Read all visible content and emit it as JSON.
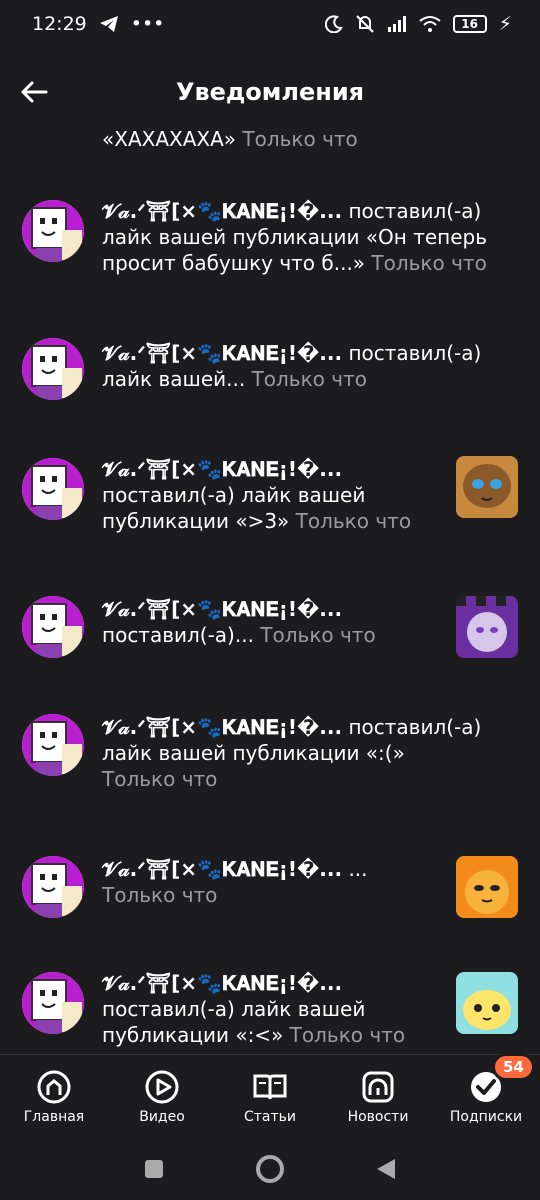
{
  "status_bar": {
    "time": "12:29",
    "battery": "16"
  },
  "header": {
    "title": "Уведомления"
  },
  "partial_top": {
    "text": "«ХАХАХАХА»",
    "time": "Только что"
  },
  "notifications": [
    {
      "username": "𝓥𝒶.ᐟ⛩[×🐾𝐊𝐀𝐍𝐄¡!�...",
      "line1": "поставил(-а)",
      "line2": "лайк вашей публикации «Он теперь",
      "line3": "просит бабушку что б...»",
      "time": "Только что",
      "thumb": ""
    },
    {
      "username": "𝓥𝒶.ᐟ⛩[×🐾𝐊𝐀𝐍𝐄¡!�...",
      "line1": "поставил(-а)",
      "line2": "лайк вашей...",
      "time": "Только что",
      "thumb": ""
    },
    {
      "username": "𝓥𝒶.ᐟ⛩[×🐾𝐊𝐀𝐍𝐄¡!�...",
      "line2": "поставил(-а) лайк вашей",
      "line3": "публикации «>3»",
      "time": "Только что",
      "thumb": "brown"
    },
    {
      "username": "𝓥𝒶.ᐟ⛩[×🐾𝐊𝐀𝐍𝐄¡!�...",
      "line2": "поставил(-а)...",
      "time": "Только что",
      "thumb": "purple"
    },
    {
      "username": "𝓥𝒶.ᐟ⛩[×🐾𝐊𝐀𝐍𝐄¡!�...",
      "line1": "поставил(-а)",
      "line2": "лайк вашей публикации «:(»",
      "time": "Только что",
      "thumb": ""
    },
    {
      "username": "𝓥𝒶.ᐟ⛩[×🐾𝐊𝐀𝐍𝐄¡!�...",
      "line1": "...",
      "time": "Только что",
      "thumb": "orange"
    },
    {
      "username": "𝓥𝒶.ᐟ⛩[×🐾𝐊𝐀𝐍𝐄¡!�...",
      "line2": "поставил(-а) лайк вашей",
      "line3": "публикации «:<»",
      "time": "Только что",
      "thumb": "yellow"
    }
  ],
  "nav": {
    "home": "Главная",
    "video": "Видео",
    "articles": "Статьи",
    "news": "Новости",
    "subscriptions": "Подписки",
    "badge": "54"
  },
  "colors": {
    "background": "#1c1c1e",
    "muted": "#9a9a9f",
    "badge": "#ff6a3d"
  }
}
